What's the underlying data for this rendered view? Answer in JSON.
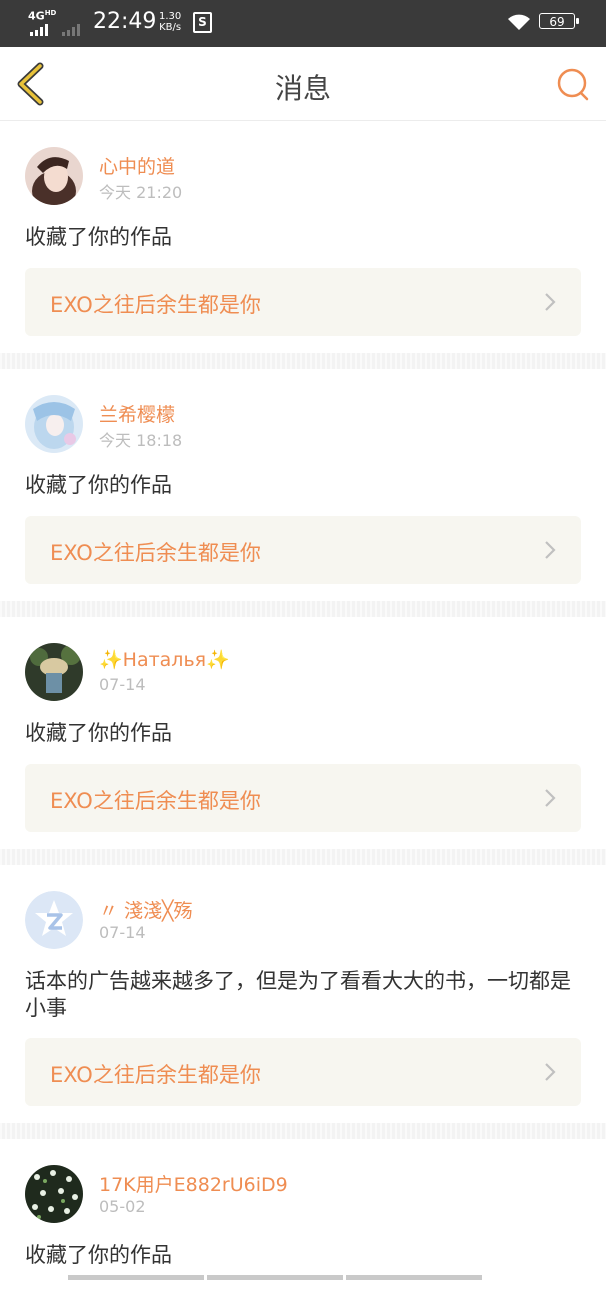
{
  "status_bar": {
    "network": "4G",
    "network_sup": "HD",
    "time": "22:49",
    "speed_value": "1.30",
    "speed_unit": "KB/s",
    "sim_badge": "S",
    "battery": "69"
  },
  "header": {
    "title": "消息",
    "back_icon": "chevron-left-icon",
    "search_icon": "search-icon"
  },
  "colors": {
    "accent": "#ef8d52",
    "back_icon": "#c8a21e",
    "card_bg": "#f7f6f0",
    "date": "#bdbdbd"
  },
  "messages": [
    {
      "user": "心中的道",
      "date": "今天 21:20",
      "text": "收藏了你的作品",
      "work": "EXO之往后余生都是你"
    },
    {
      "user": "兰希樱檬",
      "date": "今天 18:18",
      "text": "收藏了你的作品",
      "work": "EXO之往后余生都是你"
    },
    {
      "user": "✨Наталья✨",
      "date": "07-14",
      "text": "收藏了你的作品",
      "work": "EXO之往后余生都是你"
    },
    {
      "user": "〃 淺淺╳殇",
      "date": "07-14",
      "text": "话本的广告越来越多了，但是为了看看大大的书，一切都是小事",
      "work": "EXO之往后余生都是你"
    },
    {
      "user": "17K用户E882rU6iD9",
      "date": "05-02",
      "text": "收藏了你的作品"
    }
  ]
}
